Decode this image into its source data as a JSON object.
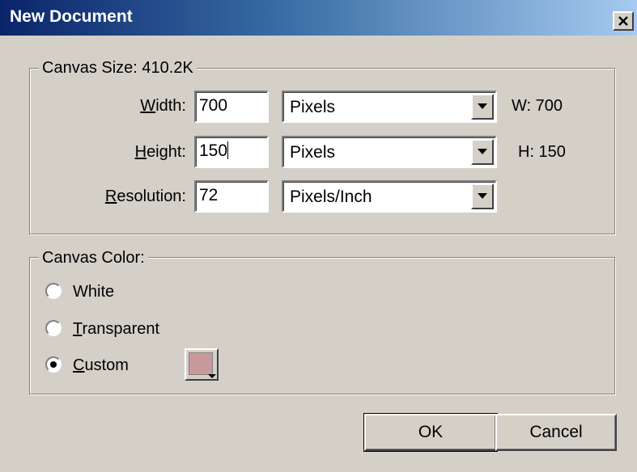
{
  "window": {
    "title": "New Document",
    "close_icon": "close-icon"
  },
  "canvas_size": {
    "legend": "Canvas Size: 410.2K",
    "width": {
      "label_mnemonic": "W",
      "label_rest": "idth:",
      "value": "700",
      "unit": "Pixels",
      "readout": "W: 700"
    },
    "height": {
      "label_mnemonic": "H",
      "label_rest": "eight:",
      "value": "150",
      "unit": "Pixels",
      "readout": "H: 150"
    },
    "resolution": {
      "label_mnemonic": "R",
      "label_rest": "esolution:",
      "value": "72",
      "unit": "Pixels/Inch"
    }
  },
  "canvas_color": {
    "legend": "Canvas Color:",
    "options": [
      {
        "mnemonic": "",
        "label_rest": "White",
        "full": "White",
        "selected": false
      },
      {
        "mnemonic": "T",
        "label_rest": "ransparent",
        "full": "Transparent",
        "selected": false
      },
      {
        "mnemonic": "C",
        "label_rest": "ustom",
        "full": "Custom",
        "selected": true
      }
    ],
    "custom_swatch_color": "#c8999b"
  },
  "buttons": {
    "ok": "OK",
    "cancel": "Cancel"
  },
  "colors": {
    "dialog_bg": "#d4d0c8",
    "titlebar_start": "#0a246a",
    "titlebar_end": "#a6caf0"
  }
}
